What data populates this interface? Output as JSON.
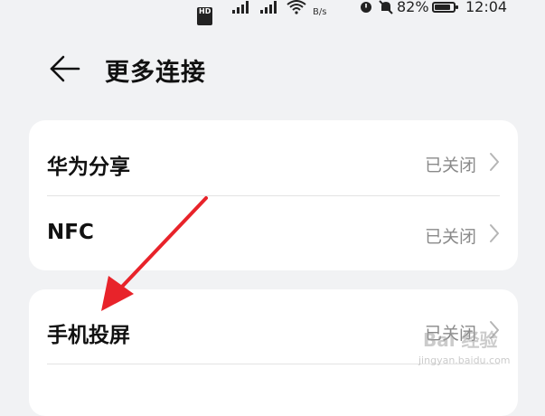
{
  "status": {
    "hd_badge": "HD",
    "network_speed": "B/s",
    "battery": "82%",
    "time": "12:04"
  },
  "header": {
    "title": "更多连接"
  },
  "cards": [
    {
      "rows": [
        {
          "label": "华为分享",
          "value": "已关闭"
        },
        {
          "label": "NFC",
          "value": "已关闭"
        }
      ]
    },
    {
      "rows": [
        {
          "label": "手机投屏",
          "value": "已关闭"
        }
      ]
    }
  ],
  "annotation": {
    "color": "#e8232a"
  },
  "watermark": {
    "text": "Bai 经验",
    "sub": "jingyan.baidu.com"
  }
}
